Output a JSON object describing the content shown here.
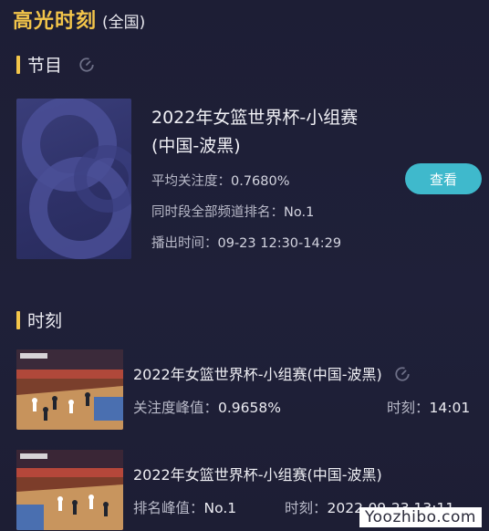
{
  "header": {
    "title": "高光时刻",
    "subtitle": "(全国)"
  },
  "program_section": {
    "label": "节目",
    "refresh_icon": "refresh-icon"
  },
  "program": {
    "title_line1": "2022年女篮世界杯-小组赛",
    "title_line2": "(中国-波黑)",
    "avg_attention_label": "平均关注度：",
    "avg_attention_value": "0.7680%",
    "rank_label": "同时段全部频道排名：",
    "rank_value": "No.1",
    "airtime_label": "播出时间：",
    "airtime_value": "09-23 12:30-14:29",
    "view_button": "查看"
  },
  "moments_section": {
    "label": "时刻"
  },
  "moments": [
    {
      "title": "2022年女篮世界杯-小组赛(中国-波黑)",
      "stat_label": "关注度峰值：",
      "stat_value": "0.9658%",
      "time_label": "时刻：",
      "time_value": "14:01",
      "has_refresh": true
    },
    {
      "title": "2022年女篮世界杯-小组赛(中国-波黑)",
      "stat_label": "排名峰值：",
      "stat_value": "No.1",
      "time_label": "时刻：",
      "time_value": "2022-09-23 13:11",
      "has_refresh": false
    }
  ],
  "watermark": "Yoozhibo.com",
  "colors": {
    "accent_yellow": "#f3c54a",
    "button_teal": "#3fb9cc",
    "background": "#1e1f36"
  }
}
